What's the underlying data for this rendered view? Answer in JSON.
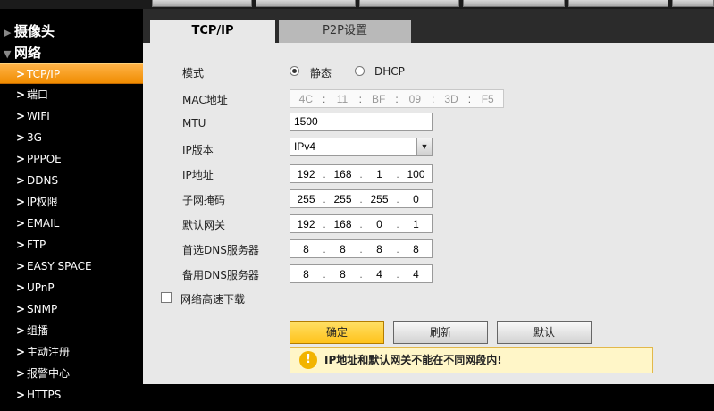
{
  "sidebar": {
    "categories": [
      {
        "label": "摄像头"
      },
      {
        "label": "网络"
      }
    ],
    "items": [
      {
        "label": "TCP/IP"
      },
      {
        "label": "端口"
      },
      {
        "label": "WIFI"
      },
      {
        "label": "3G"
      },
      {
        "label": "PPPOE"
      },
      {
        "label": "DDNS"
      },
      {
        "label": "IP权限"
      },
      {
        "label": "EMAIL"
      },
      {
        "label": "FTP"
      },
      {
        "label": "EASY SPACE"
      },
      {
        "label": "UPnP"
      },
      {
        "label": "SNMP"
      },
      {
        "label": "组播"
      },
      {
        "label": "主动注册"
      },
      {
        "label": "报警中心"
      },
      {
        "label": "HTTPS"
      }
    ]
  },
  "tabs": [
    {
      "label": "TCP/IP",
      "active": true
    },
    {
      "label": "P2P设置",
      "active": false
    }
  ],
  "form": {
    "mode": {
      "label": "模式",
      "options": [
        "静态",
        "DHCP"
      ],
      "selected": "静态"
    },
    "mac": {
      "label": "MAC地址",
      "octets": [
        "4C",
        "11",
        "BF",
        "09",
        "3D",
        "F5"
      ]
    },
    "mtu": {
      "label": "MTU",
      "value": "1500"
    },
    "ip_version": {
      "label": "IP版本",
      "value": "IPv4"
    },
    "ip_address": {
      "label": "IP地址",
      "octets": [
        "192",
        "168",
        "1",
        "100"
      ]
    },
    "subnet_mask": {
      "label": "子网掩码",
      "octets": [
        "255",
        "255",
        "255",
        "0"
      ]
    },
    "gateway": {
      "label": "默认网关",
      "octets": [
        "192",
        "168",
        "0",
        "1"
      ]
    },
    "dns1": {
      "label": "首选DNS服务器",
      "octets": [
        "8",
        "8",
        "8",
        "8"
      ]
    },
    "dns2": {
      "label": "备用DNS服务器",
      "octets": [
        "8",
        "8",
        "4",
        "4"
      ]
    },
    "high_speed": {
      "label": "网络高速下载",
      "checked": false
    }
  },
  "buttons": {
    "ok": "确定",
    "refresh": "刷新",
    "default": "默认"
  },
  "warning": {
    "icon": "!",
    "text": "IP地址和默认网关不能在不同网段内!"
  },
  "colors": {
    "accent": "#f08c00",
    "primary_button": "#ffc21a",
    "warning_bg": "#fff6c8"
  }
}
